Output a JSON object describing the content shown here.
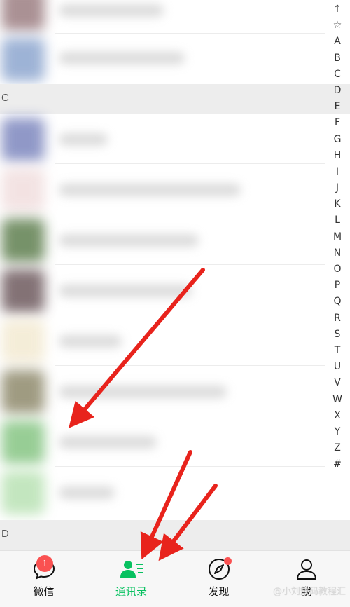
{
  "sections": [
    {
      "letter": "C"
    },
    {
      "letter": "D"
    }
  ],
  "index": [
    "↑",
    "☆",
    "A",
    "B",
    "C",
    "D",
    "E",
    "F",
    "G",
    "H",
    "I",
    "J",
    "K",
    "L",
    "M",
    "N",
    "O",
    "P",
    "Q",
    "R",
    "S",
    "T",
    "U",
    "V",
    "W",
    "X",
    "Y",
    "Z",
    "#"
  ],
  "tabbar": {
    "chats": {
      "label": "微信",
      "badge": "1"
    },
    "contacts": {
      "label": "通讯录"
    },
    "discover": {
      "label": "发现"
    },
    "me": {
      "label": "我"
    }
  },
  "colors": {
    "accent": "#07c160",
    "badge": "#fa5151",
    "arrow": "#e8231c"
  },
  "watermark": "@小刘数码教程汇"
}
